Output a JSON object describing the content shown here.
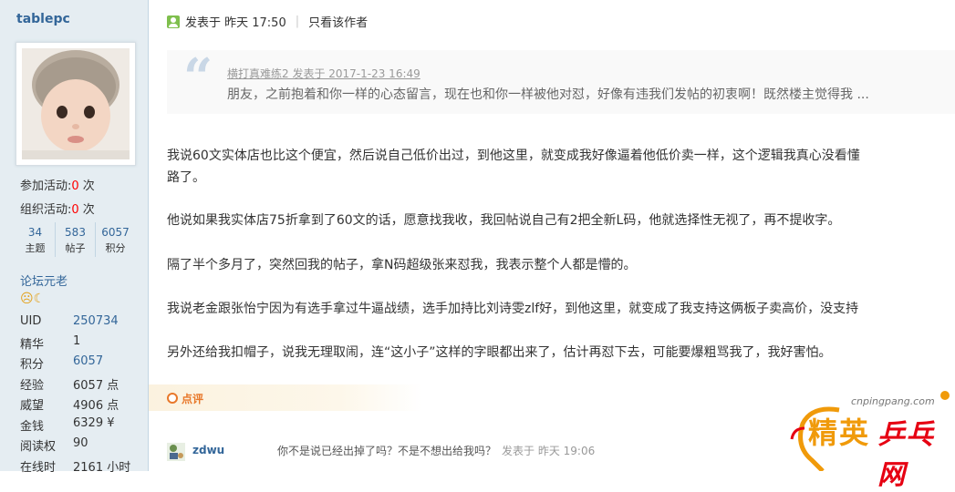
{
  "author": {
    "username": "tablepc",
    "activities": [
      {
        "label": "参加活动:",
        "count": "0",
        "unit": " 次"
      },
      {
        "label": "组织活动:",
        "count": "0",
        "unit": " 次"
      }
    ],
    "stats": [
      {
        "value": "34",
        "label": "主题"
      },
      {
        "value": "583",
        "label": "帖子"
      },
      {
        "value": "6057",
        "label": "积分"
      }
    ],
    "rank": "论坛元老",
    "medals": "☹☾",
    "info": [
      {
        "key": "UID",
        "value": "250734",
        "link": true
      },
      {
        "key": "精华",
        "value": "1",
        "link": false
      },
      {
        "key": "积分",
        "value": "6057",
        "link": true
      },
      {
        "key": "经验",
        "value": "6057 点",
        "link": false
      },
      {
        "key": "威望",
        "value": "4906 点",
        "link": false
      },
      {
        "key": "金钱",
        "value": "6329 ¥",
        "link": false
      },
      {
        "key": "阅读权",
        "value": "90",
        "link": false
      },
      {
        "key": "在线时",
        "value": "2161 小时",
        "link": false
      }
    ]
  },
  "post": {
    "posted_label": "发表于 昨天 17:50",
    "only_author": "只看该作者",
    "quote": {
      "source": "横打真难练2 发表于 2017-1-23 16:49",
      "text": "朋友，之前抱着和你一样的心态留言，现在也和你一样被他对怼，好像有违我们发帖的初衷啊！既然楼主觉得我 ..."
    },
    "paragraphs": [
      "我说60文实体店也比这个便宜，然后说自己低价出过，到他这里，就变成我好像逼着他低价卖一样，这个逻辑我真心没看懂",
      "路了。",
      "他说如果我实体店75折拿到了60文的话，愿意找我收，我回帖说自己有2把全新L码，他就选择性无视了，再不提收字。",
      "隔了半个多月了，突然回我的帖子，拿N码超级张来怼我，我表示整个人都是懵的。",
      "我说老金跟张怡宁因为有选手拿过牛逼战绩，选手加持比刘诗雯zlf好，到他这里，就变成了我支持这俩板子卖高价，没支持",
      "另外还给我扣帽子，说我无理取闹，连“这小子”这样的字眼都出来了，估计再怼下去，可能要爆粗骂我了，我好害怕。"
    ],
    "rate_label": "点评"
  },
  "comment": {
    "user": "zdwu",
    "text": "你不是说已经出掉了吗？不是不想出给我吗？",
    "time": "发表于 昨天 19:06"
  },
  "watermark": {
    "url": "cnpingpang.com",
    "cn1": "精英",
    "cn2": "乒乓网"
  }
}
